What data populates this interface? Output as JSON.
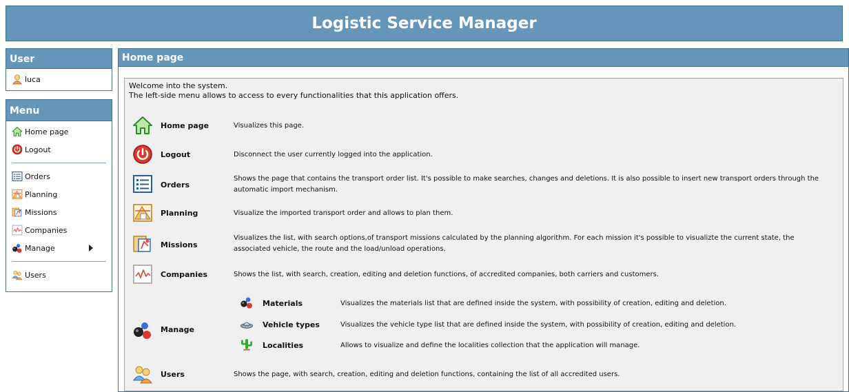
{
  "app": {
    "title": "Logistic Service Manager"
  },
  "user_panel": {
    "title": "User",
    "username": "luca"
  },
  "menu_panel": {
    "title": "Menu",
    "items": [
      {
        "label": "Home page",
        "icon": "home-icon"
      },
      {
        "label": "Logout",
        "icon": "power-icon"
      },
      {
        "label": "Orders",
        "icon": "list-icon"
      },
      {
        "label": "Planning",
        "icon": "planning-icon"
      },
      {
        "label": "Missions",
        "icon": "missions-icon"
      },
      {
        "label": "Companies",
        "icon": "chart-icon"
      },
      {
        "label": "Manage",
        "icon": "molecule-icon"
      },
      {
        "label": "Users",
        "icon": "users-icon"
      }
    ]
  },
  "main": {
    "title": "Home page",
    "welcome_line1": "Welcome into the system.",
    "welcome_line2": "The left-side menu allows to access to every functionalities that this application offers.",
    "entries": [
      {
        "name": "Home page",
        "desc": "Visualizes this page."
      },
      {
        "name": "Logout",
        "desc": "Disconnect the user currently logged into the application."
      },
      {
        "name": "Orders",
        "desc": "Shows the page that contains the transport order list. It's possible to make searches, changes and deletions. It is also possible to insert new transport orders through the automatic import mechanism."
      },
      {
        "name": "Planning",
        "desc": "Visualize the imported transport order and allows to plan them."
      },
      {
        "name": "Missions",
        "desc": "Visualizes the list, with search options,of transport missions calculated by the planning algorithm. For each mission it's possible to visualizte the current state, the associated vehicle, the route and the load/unload operations."
      },
      {
        "name": "Companies",
        "desc": "Shows the list, with search, creation, editing and deletion functions, of accredited companies, both carriers and customers."
      },
      {
        "name": "Manage",
        "desc": ""
      },
      {
        "name": "Users",
        "desc": "Shows the page, with search, creation, editing and deletion functions, containing the list of all accredited users."
      }
    ],
    "manage_sub": [
      {
        "name": "Materials",
        "desc": "Visualizes the materials list that are defined inside the system, with possibility of creation, editing and deletion."
      },
      {
        "name": "Vehicle types",
        "desc": "Visualizes the vehicle type list that are defined inside the system, with possibility of creation, editing and deletion."
      },
      {
        "name": "Localities",
        "desc": "Allows to visualize and define the localities collection that the application will manage."
      }
    ]
  },
  "colors": {
    "header": "#6396b8",
    "border": "#45708f",
    "content_bg": "#f0f0f0"
  }
}
